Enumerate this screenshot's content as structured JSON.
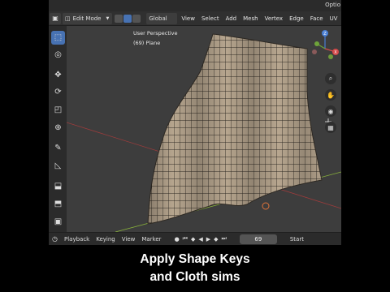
{
  "header": {
    "mode": "Edit Mode",
    "orientation": "Global",
    "menus": [
      "View",
      "Select",
      "Add",
      "Mesh",
      "Vertex",
      "Edge",
      "Face",
      "UV"
    ],
    "options_label": "Optio"
  },
  "viewport": {
    "perspective_label": "User Perspective",
    "object_label": "(69) Plane",
    "gizmo": {
      "z": "Z",
      "x": "X",
      "y": "Y"
    }
  },
  "timeline": {
    "playback": "Playback",
    "keying": "Keying",
    "view": "View",
    "marker": "Marker",
    "current_frame": "69",
    "start_label": "Start"
  },
  "caption": {
    "line1": "Apply Shape Keys",
    "line2": "and Cloth sims"
  },
  "colors": {
    "accent": "#4772b3",
    "viewport_bg": "#3d3d3d",
    "cloth": "#b8a78f",
    "grid_x": "#9c3c3c",
    "grid_y": "#8ab33c"
  },
  "icons": {
    "tools": [
      "select-box-icon",
      "cursor-icon",
      "move-icon",
      "rotate-icon",
      "scale-icon",
      "transform-icon",
      "annotate-icon",
      "measure-icon",
      "add-cube-icon",
      "extrude-icon",
      "inset-icon",
      "bevel-icon"
    ],
    "nav": [
      "zoom-icon",
      "pan-hand-icon",
      "camera-icon",
      "grid-view-icon"
    ]
  }
}
